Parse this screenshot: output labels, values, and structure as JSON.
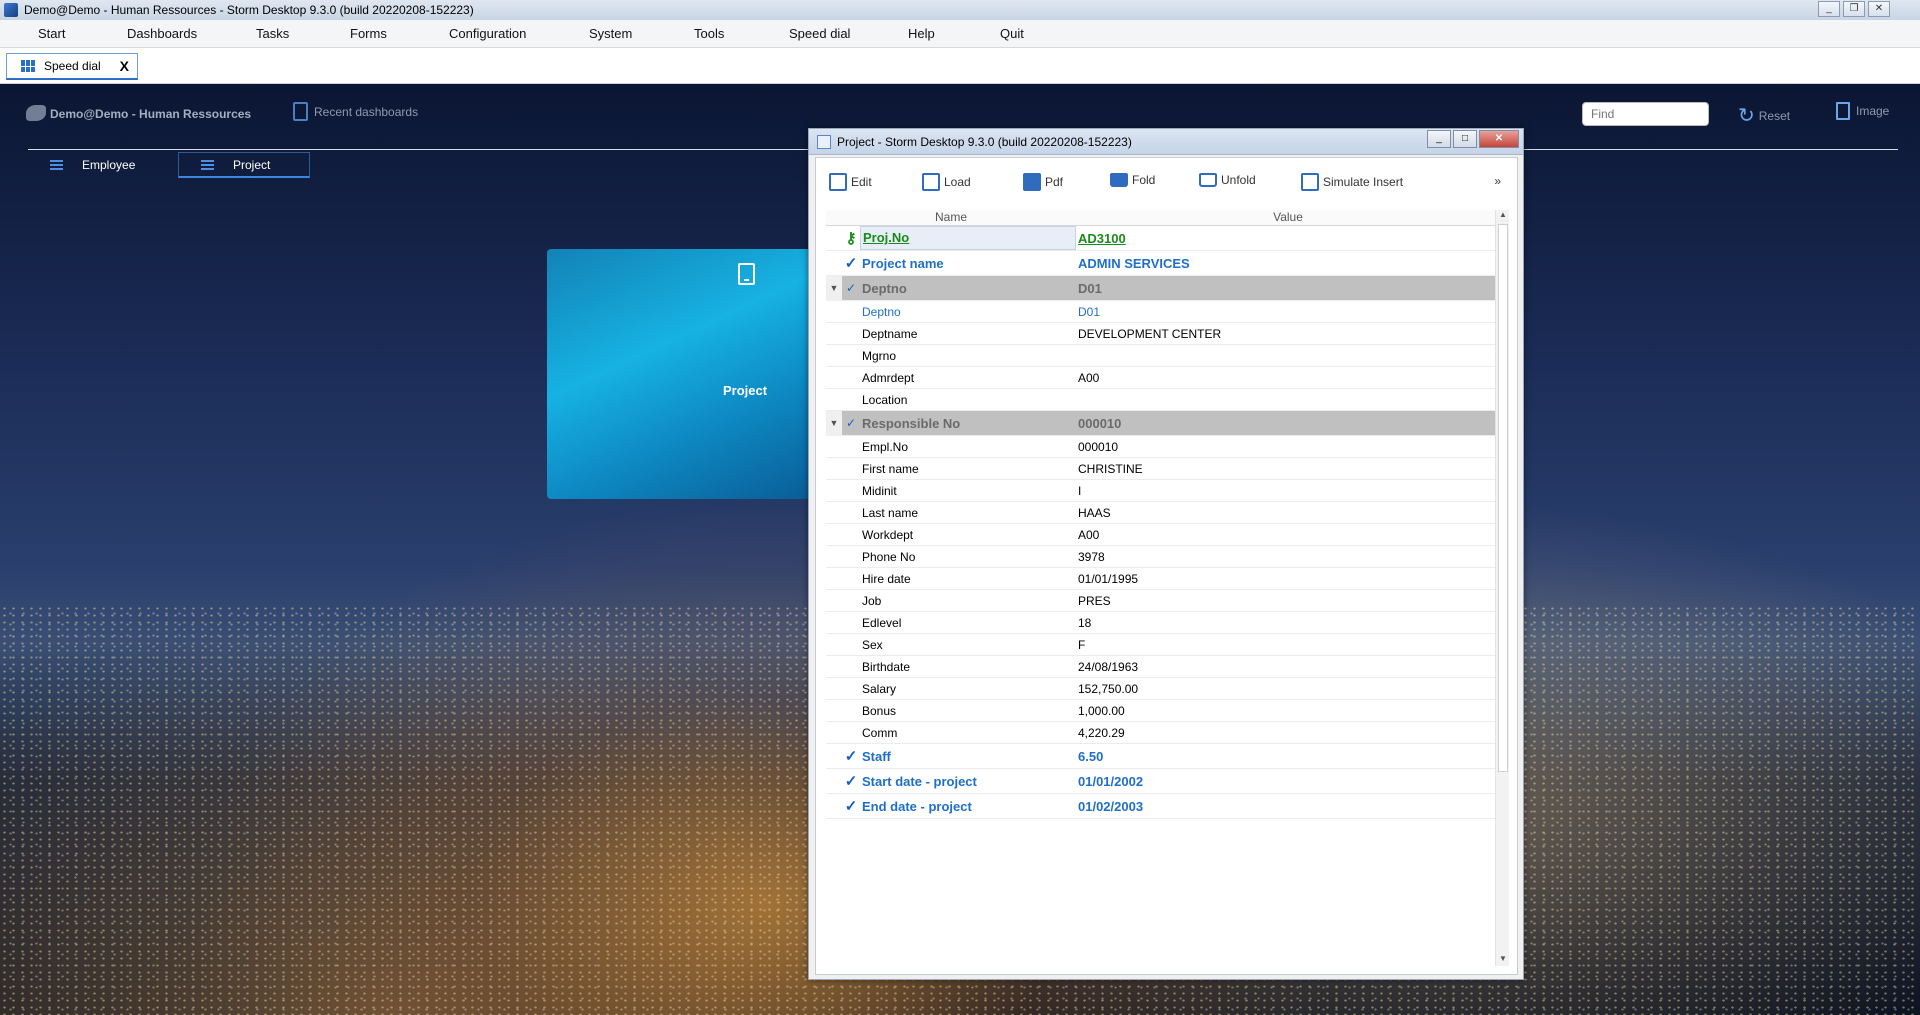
{
  "window_title": "Demo@Demo - Human Ressources -  Storm Desktop 9.3.0 (build 20220208-152223)",
  "menu": [
    "Start",
    "Dashboards",
    "Tasks",
    "Forms",
    "Configuration",
    "System",
    "Tools",
    "Speed dial",
    "Help",
    "Quit"
  ],
  "tab": {
    "label": "Speed dial",
    "close": "X"
  },
  "dashboard": {
    "title": "Demo@Demo - Human Ressources",
    "recent": "Recent dashboards",
    "find_placeholder": "Find",
    "reset": "Reset",
    "image": "Image",
    "tabs": [
      "Employee",
      "Project"
    ]
  },
  "tile": {
    "label": "Project",
    "icon": "tablet-icon"
  },
  "project_window": {
    "title": "Project -  Storm Desktop 9.3.0 (build 20220208-152223)",
    "toolbar": [
      "Edit",
      "Load",
      "Pdf",
      "Fold",
      "Unfold",
      "Simulate Insert"
    ],
    "more": "»",
    "columns": [
      "Name",
      "Value"
    ],
    "rows": [
      {
        "kind": "key",
        "name": "Proj.No",
        "value": "AD3100"
      },
      {
        "kind": "main",
        "name": "Project name",
        "value": "ADMIN SERVICES"
      },
      {
        "kind": "group",
        "name": "Deptno",
        "value": "D01"
      },
      {
        "kind": "sublink",
        "name": "Deptno",
        "value": "D01"
      },
      {
        "kind": "sub",
        "name": "Deptname",
        "value": "DEVELOPMENT CENTER"
      },
      {
        "kind": "sub",
        "name": "Mgrno",
        "value": ""
      },
      {
        "kind": "sub",
        "name": "Admrdept",
        "value": "A00"
      },
      {
        "kind": "sub",
        "name": "Location",
        "value": ""
      },
      {
        "kind": "group",
        "name": "Responsible No",
        "value": "000010"
      },
      {
        "kind": "sub",
        "name": "Empl.No",
        "value": "000010"
      },
      {
        "kind": "sub",
        "name": "First name",
        "value": "CHRISTINE"
      },
      {
        "kind": "sub",
        "name": "Midinit",
        "value": "I"
      },
      {
        "kind": "sub",
        "name": "Last name",
        "value": "HAAS"
      },
      {
        "kind": "sub",
        "name": "Workdept",
        "value": "A00"
      },
      {
        "kind": "sub",
        "name": "Phone No",
        "value": "3978"
      },
      {
        "kind": "sub",
        "name": "Hire date",
        "value": "01/01/1995"
      },
      {
        "kind": "sub",
        "name": "Job",
        "value": "PRES"
      },
      {
        "kind": "sub",
        "name": "Edlevel",
        "value": "18"
      },
      {
        "kind": "sub",
        "name": "Sex",
        "value": "F"
      },
      {
        "kind": "sub",
        "name": "Birthdate",
        "value": "24/08/1963"
      },
      {
        "kind": "sub",
        "name": "Salary",
        "value": "152,750.00"
      },
      {
        "kind": "sub",
        "name": "Bonus",
        "value": "1,000.00"
      },
      {
        "kind": "sub",
        "name": "Comm",
        "value": "4,220.29"
      },
      {
        "kind": "main",
        "name": "Staff",
        "value": "6.50"
      },
      {
        "kind": "main",
        "name": "Start date - project",
        "value": "01/01/2002"
      },
      {
        "kind": "main",
        "name": "End date - project",
        "value": "01/02/2003"
      }
    ]
  },
  "colors": {
    "accent": "#1f6fc8",
    "key_green": "#1a8a1a",
    "group_bg": "#c0c0c0",
    "tile": "#16b2e2"
  }
}
